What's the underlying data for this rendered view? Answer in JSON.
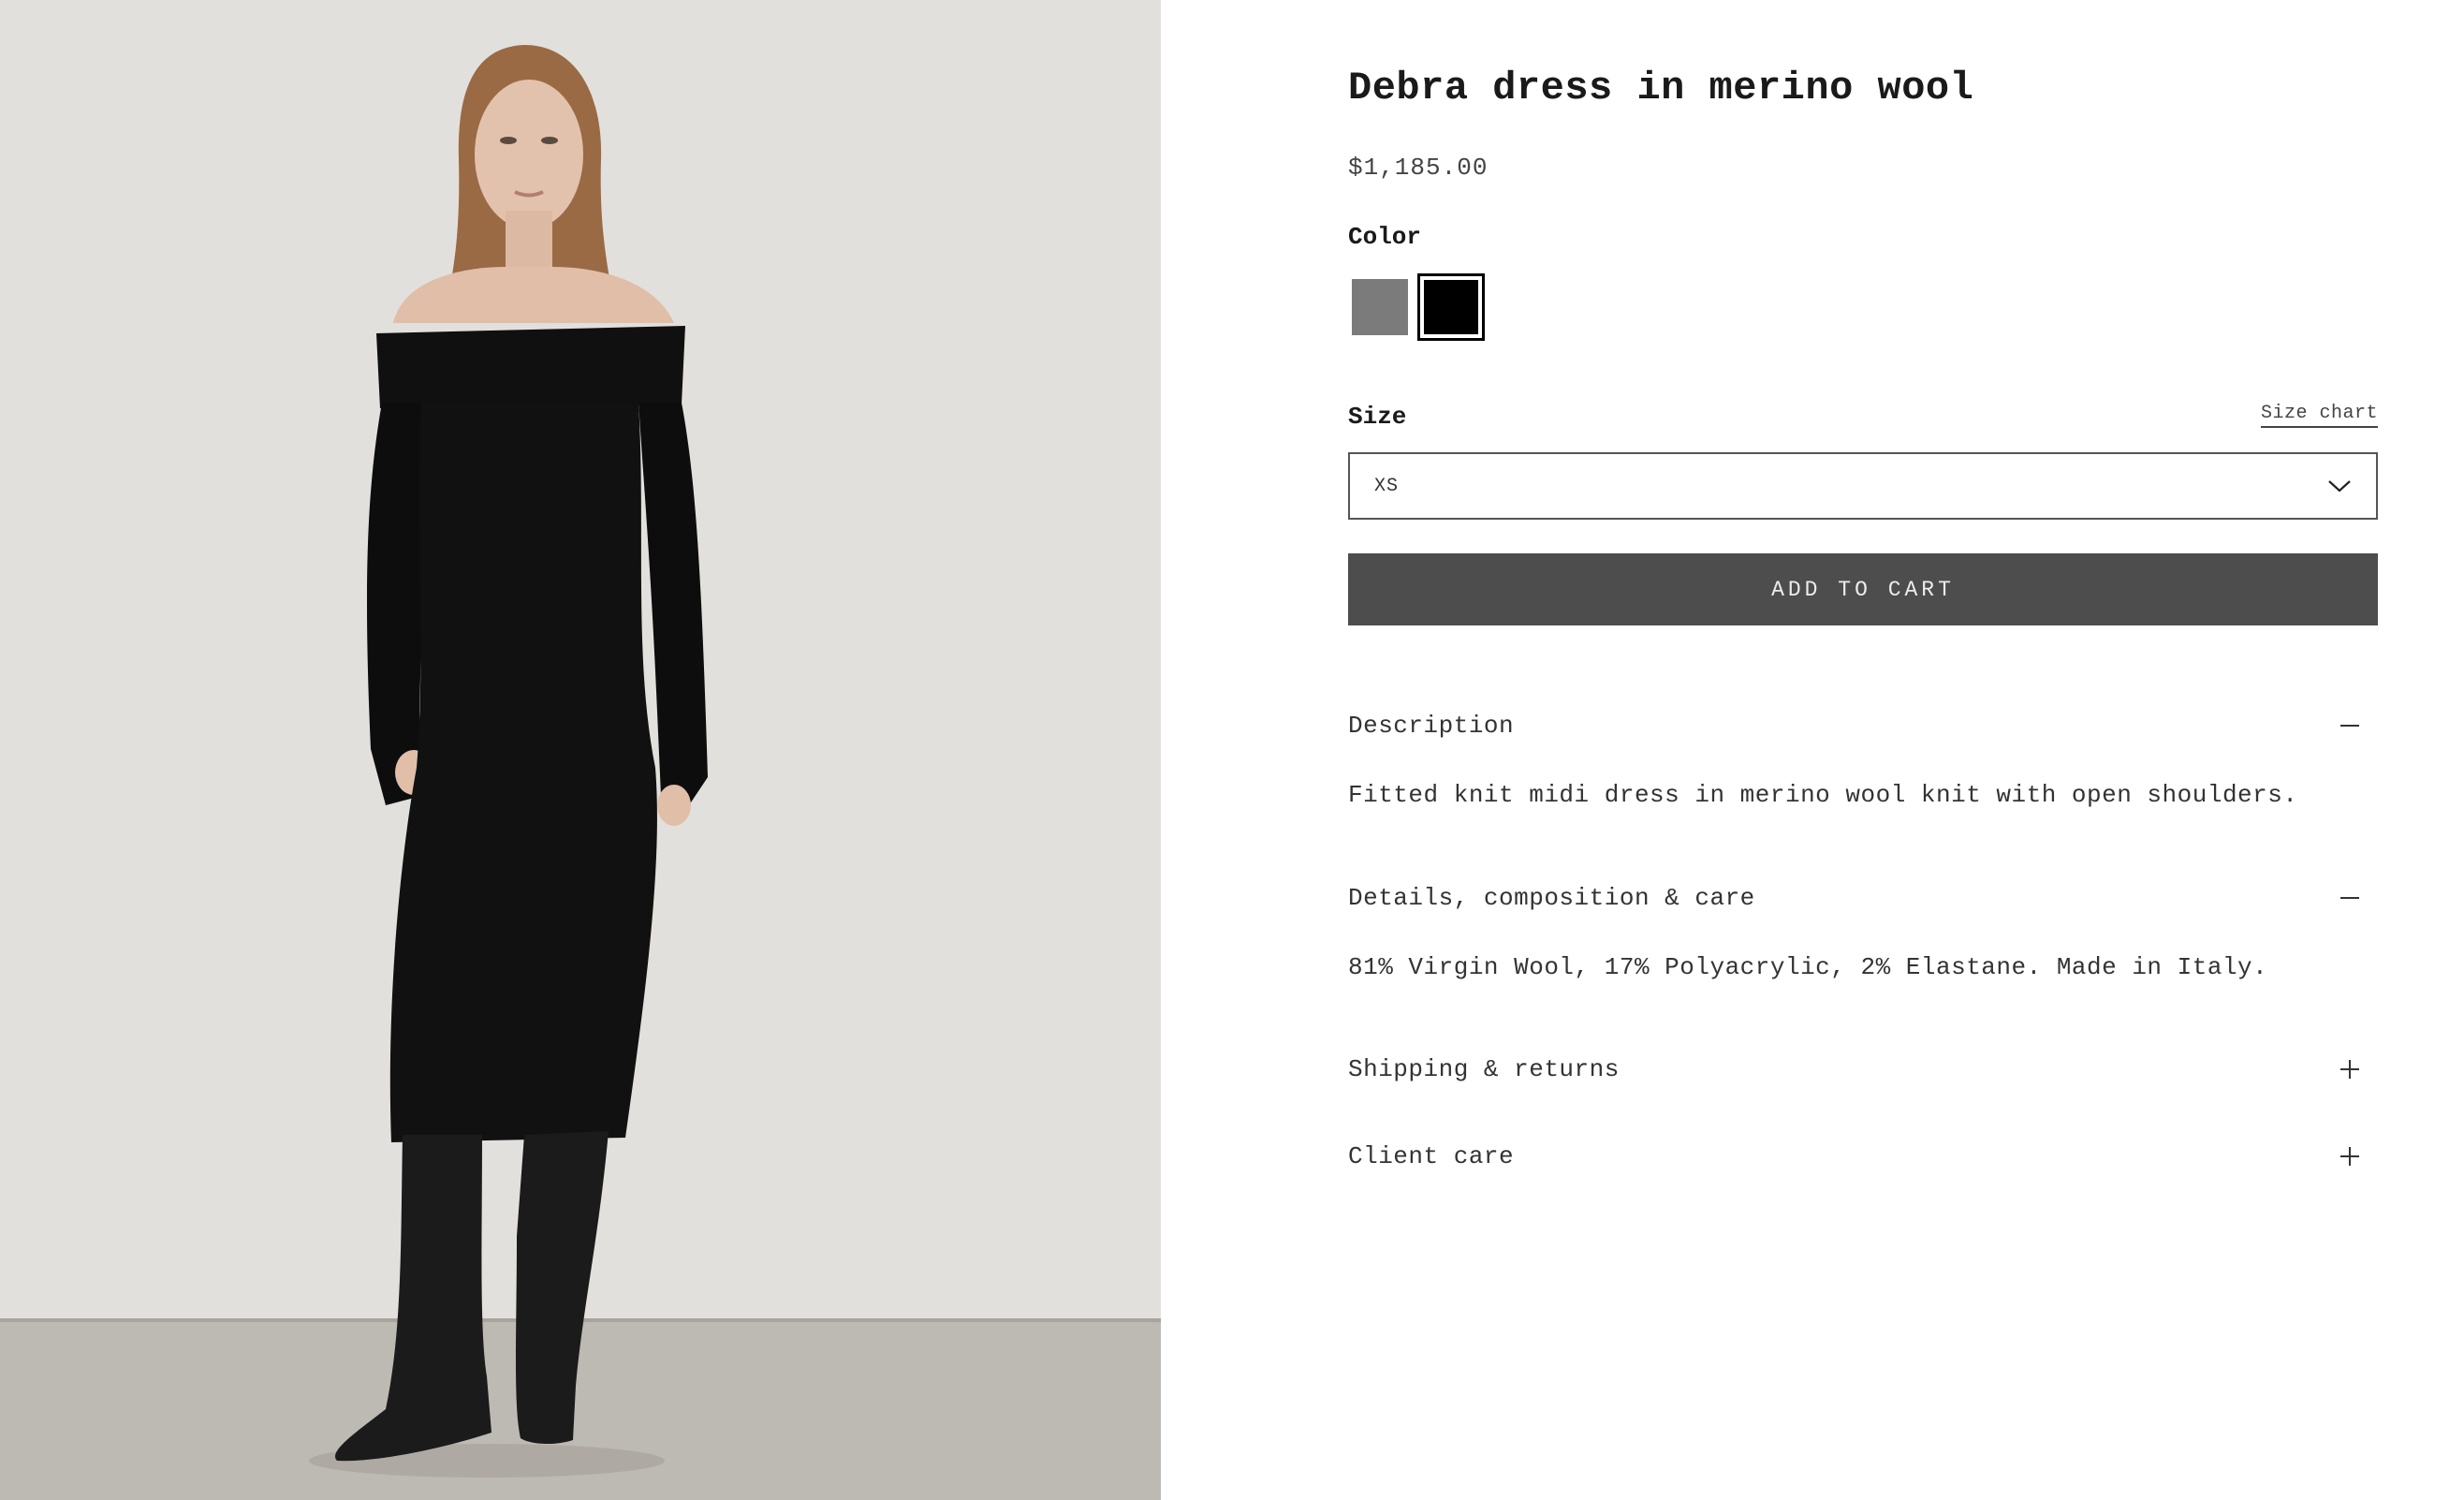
{
  "product": {
    "title": "Debra dress in merino wool",
    "price": "$1,185.00",
    "image_alt": "Model wearing black off-shoulder knit midi dress with black knee-high boots"
  },
  "color": {
    "label": "Color",
    "options": [
      {
        "name": "Grey",
        "hex": "#7b7b7b",
        "selected": false
      },
      {
        "name": "Black",
        "hex": "#000000",
        "selected": true
      }
    ]
  },
  "size": {
    "label": "Size",
    "chart_link": "Size chart",
    "selected": "XS"
  },
  "cart": {
    "button_label": "ADD TO CART"
  },
  "accordion": [
    {
      "title": "Description",
      "expanded": true,
      "body": "Fitted knit midi dress in merino wool knit with open shoulders."
    },
    {
      "title": "Details, composition & care",
      "expanded": true,
      "body": "81% Virgin Wool, 17% Polyacrylic, 2% Elastane. Made in Italy."
    },
    {
      "title": "Shipping & returns",
      "expanded": false
    },
    {
      "title": "Client care",
      "expanded": false
    }
  ],
  "icons": {
    "size_dropdown": "chevron-down-icon",
    "expanded": "minus-icon",
    "collapsed": "plus-icon"
  },
  "colors": {
    "button_bg": "#4d4d4d",
    "text": "#1a1a1a"
  }
}
